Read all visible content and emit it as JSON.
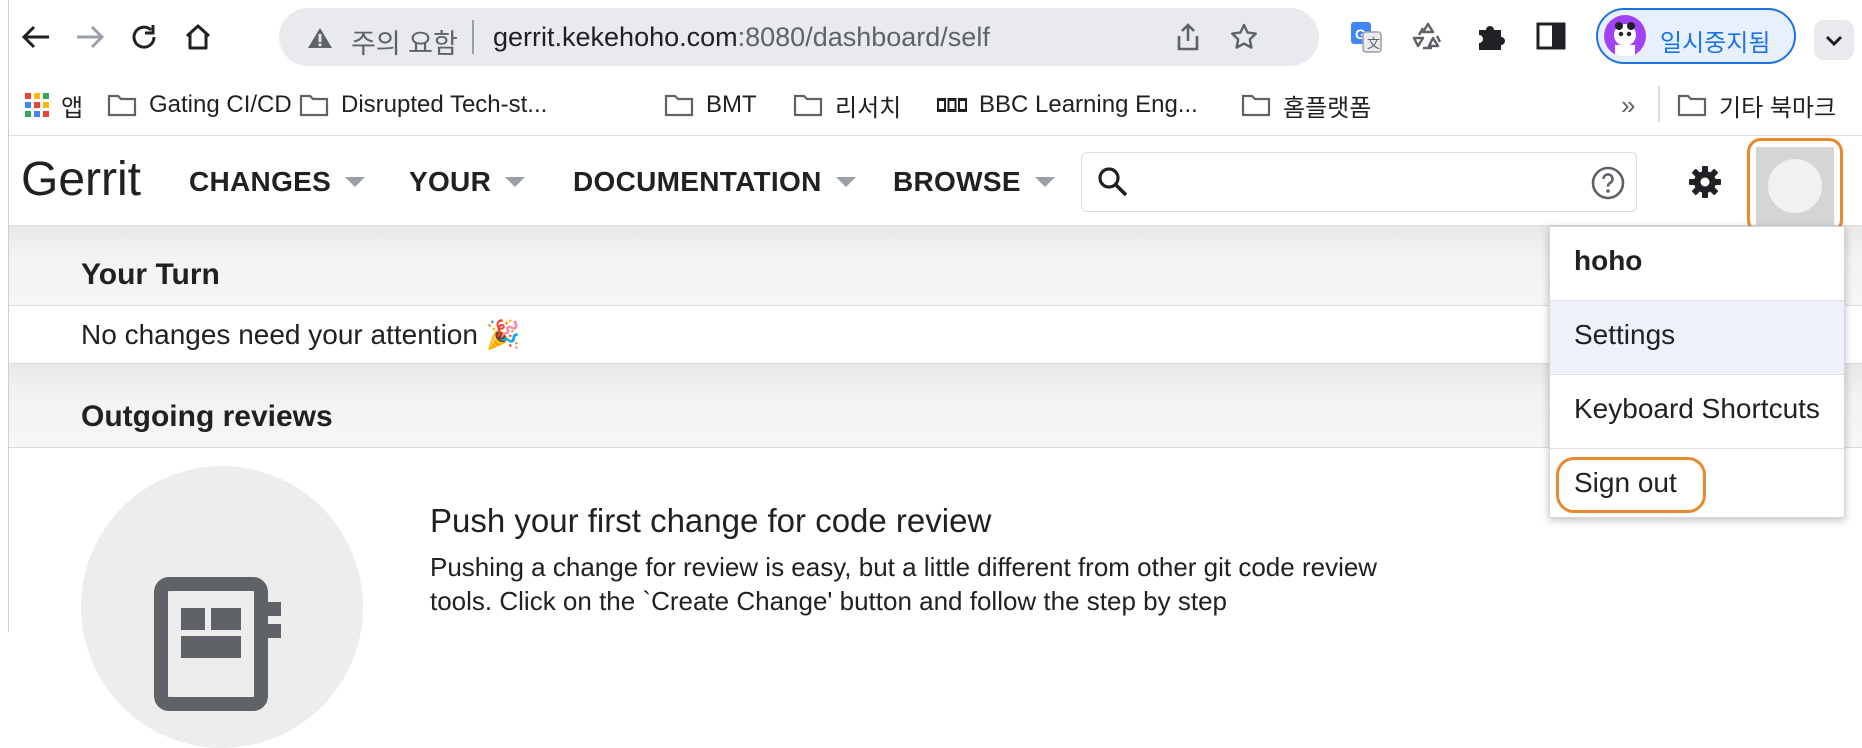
{
  "browser": {
    "site_status": "주의 요함",
    "url_host": "gerrit.kekehoho.com",
    "url_path": ":8080/dashboard/self",
    "profile_label": "일시중지됨",
    "accent_color": "#1a73e8"
  },
  "bookmarks": {
    "apps": "앱",
    "items": [
      "Gating CI/CD",
      "Disrupted Tech-st...",
      "BMT",
      "리서치",
      "BBC Learning Eng...",
      "홈플랫폼"
    ],
    "overflow": "»",
    "other": "기타 북마크"
  },
  "gerrit": {
    "logo": "Gerrit",
    "nav": [
      "CHANGES",
      "YOUR",
      "DOCUMENTATION",
      "BROWSE"
    ],
    "search_placeholder": ""
  },
  "dashboard": {
    "your_turn_title": "Your Turn",
    "your_turn_empty": "No changes need your attention 🎉",
    "outgoing_title": "Outgoing reviews",
    "push_title": "Push your first change for code review",
    "push_body": "Pushing a change for review is easy, but a little different from other git code review tools. Click on the `Create Change' button and follow the step by step"
  },
  "account_menu": {
    "username": "hoho",
    "items": [
      "Settings",
      "Keyboard Shortcuts",
      "Sign out"
    ],
    "highlight_color": "#e8892f"
  }
}
